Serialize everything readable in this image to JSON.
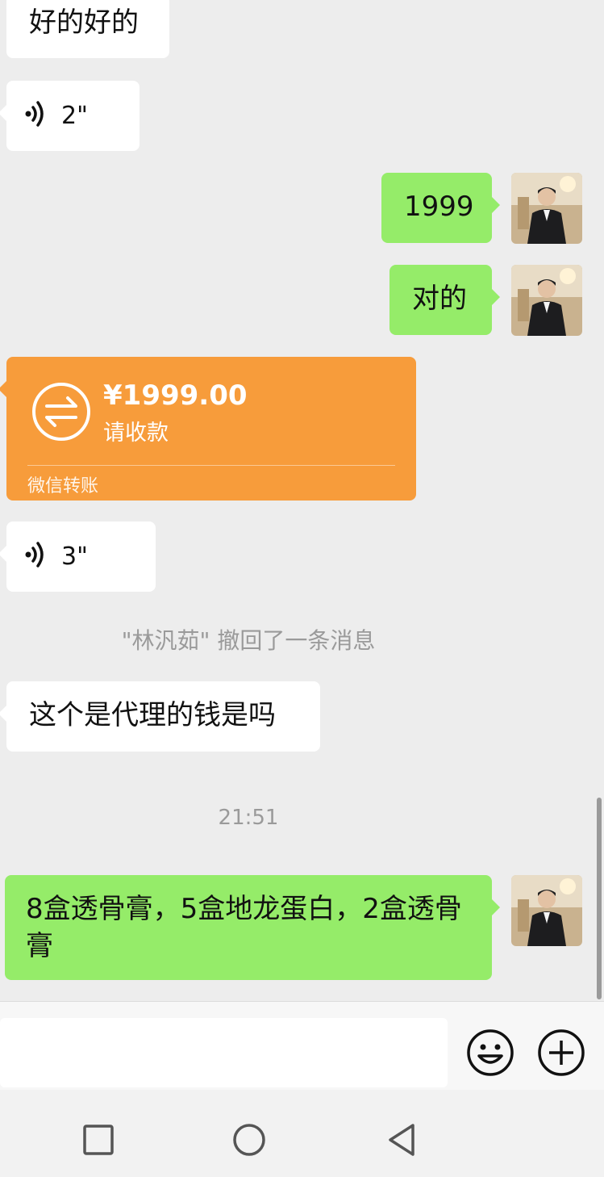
{
  "messages": {
    "m1_text": "好的好的",
    "m2_voice": "2\"",
    "m3_text": "1999",
    "m4_text": "对的",
    "m5_transfer": {
      "amount": "¥1999.00",
      "status": "请收款",
      "footer": "微信转账"
    },
    "m6_voice": "3\"",
    "system_recall": "\"林汎茹\" 撤回了一条消息",
    "m7_text": "这个是代理的钱是吗",
    "time": "21:51",
    "m8_text": "8盒透骨膏，5盒地龙蛋白，2盒透骨膏"
  },
  "icons": {
    "voice": "voice-wave-icon",
    "transfer": "transfer-arrows-icon",
    "emoji": "emoji-icon",
    "plus": "plus-icon",
    "recent": "square-recent-icon",
    "home": "circle-home-icon",
    "back": "triangle-back-icon"
  },
  "colors": {
    "background": "#ededed",
    "sent_bubble": "#95ec69",
    "received_bubble": "#ffffff",
    "transfer_bubble": "#f79c3b"
  }
}
